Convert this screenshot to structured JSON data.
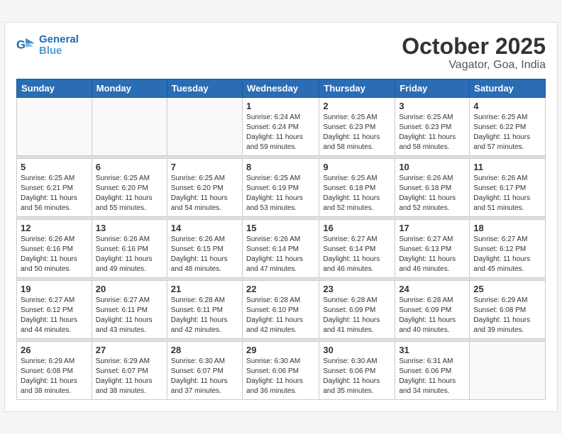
{
  "header": {
    "logo_line1": "General",
    "logo_line2": "Blue",
    "month": "October 2025",
    "location": "Vagator, Goa, India"
  },
  "weekdays": [
    "Sunday",
    "Monday",
    "Tuesday",
    "Wednesday",
    "Thursday",
    "Friday",
    "Saturday"
  ],
  "weeks": [
    [
      {
        "day": "",
        "info": ""
      },
      {
        "day": "",
        "info": ""
      },
      {
        "day": "",
        "info": ""
      },
      {
        "day": "1",
        "info": "Sunrise: 6:24 AM\nSunset: 6:24 PM\nDaylight: 11 hours\nand 59 minutes."
      },
      {
        "day": "2",
        "info": "Sunrise: 6:25 AM\nSunset: 6:23 PM\nDaylight: 11 hours\nand 58 minutes."
      },
      {
        "day": "3",
        "info": "Sunrise: 6:25 AM\nSunset: 6:23 PM\nDaylight: 11 hours\nand 58 minutes."
      },
      {
        "day": "4",
        "info": "Sunrise: 6:25 AM\nSunset: 6:22 PM\nDaylight: 11 hours\nand 57 minutes."
      }
    ],
    [
      {
        "day": "5",
        "info": "Sunrise: 6:25 AM\nSunset: 6:21 PM\nDaylight: 11 hours\nand 56 minutes."
      },
      {
        "day": "6",
        "info": "Sunrise: 6:25 AM\nSunset: 6:20 PM\nDaylight: 11 hours\nand 55 minutes."
      },
      {
        "day": "7",
        "info": "Sunrise: 6:25 AM\nSunset: 6:20 PM\nDaylight: 11 hours\nand 54 minutes."
      },
      {
        "day": "8",
        "info": "Sunrise: 6:25 AM\nSunset: 6:19 PM\nDaylight: 11 hours\nand 53 minutes."
      },
      {
        "day": "9",
        "info": "Sunrise: 6:25 AM\nSunset: 6:18 PM\nDaylight: 11 hours\nand 52 minutes."
      },
      {
        "day": "10",
        "info": "Sunrise: 6:26 AM\nSunset: 6:18 PM\nDaylight: 11 hours\nand 52 minutes."
      },
      {
        "day": "11",
        "info": "Sunrise: 6:26 AM\nSunset: 6:17 PM\nDaylight: 11 hours\nand 51 minutes."
      }
    ],
    [
      {
        "day": "12",
        "info": "Sunrise: 6:26 AM\nSunset: 6:16 PM\nDaylight: 11 hours\nand 50 minutes."
      },
      {
        "day": "13",
        "info": "Sunrise: 6:26 AM\nSunset: 6:16 PM\nDaylight: 11 hours\nand 49 minutes."
      },
      {
        "day": "14",
        "info": "Sunrise: 6:26 AM\nSunset: 6:15 PM\nDaylight: 11 hours\nand 48 minutes."
      },
      {
        "day": "15",
        "info": "Sunrise: 6:26 AM\nSunset: 6:14 PM\nDaylight: 11 hours\nand 47 minutes."
      },
      {
        "day": "16",
        "info": "Sunrise: 6:27 AM\nSunset: 6:14 PM\nDaylight: 11 hours\nand 46 minutes."
      },
      {
        "day": "17",
        "info": "Sunrise: 6:27 AM\nSunset: 6:13 PM\nDaylight: 11 hours\nand 46 minutes."
      },
      {
        "day": "18",
        "info": "Sunrise: 6:27 AM\nSunset: 6:12 PM\nDaylight: 11 hours\nand 45 minutes."
      }
    ],
    [
      {
        "day": "19",
        "info": "Sunrise: 6:27 AM\nSunset: 6:12 PM\nDaylight: 11 hours\nand 44 minutes."
      },
      {
        "day": "20",
        "info": "Sunrise: 6:27 AM\nSunset: 6:11 PM\nDaylight: 11 hours\nand 43 minutes."
      },
      {
        "day": "21",
        "info": "Sunrise: 6:28 AM\nSunset: 6:11 PM\nDaylight: 11 hours\nand 42 minutes."
      },
      {
        "day": "22",
        "info": "Sunrise: 6:28 AM\nSunset: 6:10 PM\nDaylight: 11 hours\nand 42 minutes."
      },
      {
        "day": "23",
        "info": "Sunrise: 6:28 AM\nSunset: 6:09 PM\nDaylight: 11 hours\nand 41 minutes."
      },
      {
        "day": "24",
        "info": "Sunrise: 6:28 AM\nSunset: 6:09 PM\nDaylight: 11 hours\nand 40 minutes."
      },
      {
        "day": "25",
        "info": "Sunrise: 6:29 AM\nSunset: 6:08 PM\nDaylight: 11 hours\nand 39 minutes."
      }
    ],
    [
      {
        "day": "26",
        "info": "Sunrise: 6:29 AM\nSunset: 6:08 PM\nDaylight: 11 hours\nand 38 minutes."
      },
      {
        "day": "27",
        "info": "Sunrise: 6:29 AM\nSunset: 6:07 PM\nDaylight: 11 hours\nand 38 minutes."
      },
      {
        "day": "28",
        "info": "Sunrise: 6:30 AM\nSunset: 6:07 PM\nDaylight: 11 hours\nand 37 minutes."
      },
      {
        "day": "29",
        "info": "Sunrise: 6:30 AM\nSunset: 6:06 PM\nDaylight: 11 hours\nand 36 minutes."
      },
      {
        "day": "30",
        "info": "Sunrise: 6:30 AM\nSunset: 6:06 PM\nDaylight: 11 hours\nand 35 minutes."
      },
      {
        "day": "31",
        "info": "Sunrise: 6:31 AM\nSunset: 6:06 PM\nDaylight: 11 hours\nand 34 minutes."
      },
      {
        "day": "",
        "info": ""
      }
    ]
  ]
}
